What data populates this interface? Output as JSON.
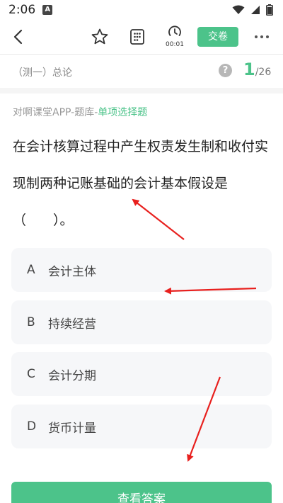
{
  "status_bar": {
    "time": "2:06",
    "notif_letter": "A"
  },
  "toolbar": {
    "timer_text": "00:01",
    "submit_label": "交卷"
  },
  "section": {
    "title": "（测一）总论",
    "progress_current": "1",
    "progress_total": "/26",
    "help_symbol": "?"
  },
  "question": {
    "source": "对啊课堂APP-题库-",
    "type": "单项选择题",
    "text": "在会计核算过程中产生权责发生制和收付实现制两种记账基础的会计基本假设是（　　）。"
  },
  "options": [
    {
      "letter": "A",
      "text": "会计主体"
    },
    {
      "letter": "B",
      "text": "持续经营"
    },
    {
      "letter": "C",
      "text": "会计分期"
    },
    {
      "letter": "D",
      "text": "货币计量"
    }
  ],
  "bottom": {
    "view_answer_label": "查看答案"
  },
  "colors": {
    "accent": "#4cc38a",
    "annotation": "#e8201e"
  }
}
